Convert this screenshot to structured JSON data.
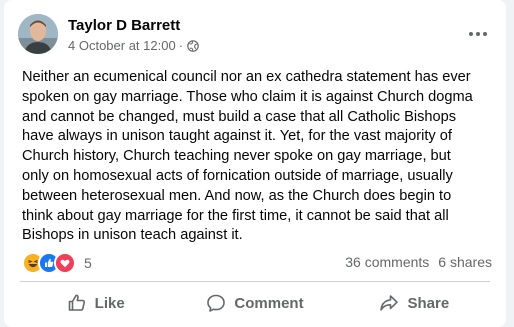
{
  "post": {
    "author": "Taylor D Barrett",
    "date": "4 October at 12:00",
    "separator": "·",
    "audience_icon": "globe-icon",
    "more_icon": "more-options-icon",
    "text_lines": [
      "Neither an ecumenical council nor an ex cathedra statement has ever",
      "spoken on gay marriage. Those who claim it is against Church dogma",
      "and cannot be changed, must build a case that all Catholic Bishops",
      "have always in unison taught against it. Yet, for the vast majority of",
      "Church history, Church teaching never spoke on gay marriage, but",
      "only on homosexual acts of fornication outside of marriage, usually",
      "between heterosexual men. And now, as the Church does begin to",
      "think about gay marriage for the first time, it cannot be said that all",
      "Bishops in unison teach against it."
    ]
  },
  "stats": {
    "reaction_icons": [
      "haha-icon",
      "like-icon",
      "love-icon"
    ],
    "reaction_count": "5",
    "comments": "36 comments",
    "shares": "6 shares"
  },
  "actions": {
    "like": "Like",
    "comment": "Comment",
    "share": "Share"
  },
  "colors": {
    "like_blue": "#1877f2",
    "love_red": "#f33e58",
    "haha_yellow": "#f7b125",
    "secondary_text": "#65676b",
    "background": "#f0f2f5"
  }
}
